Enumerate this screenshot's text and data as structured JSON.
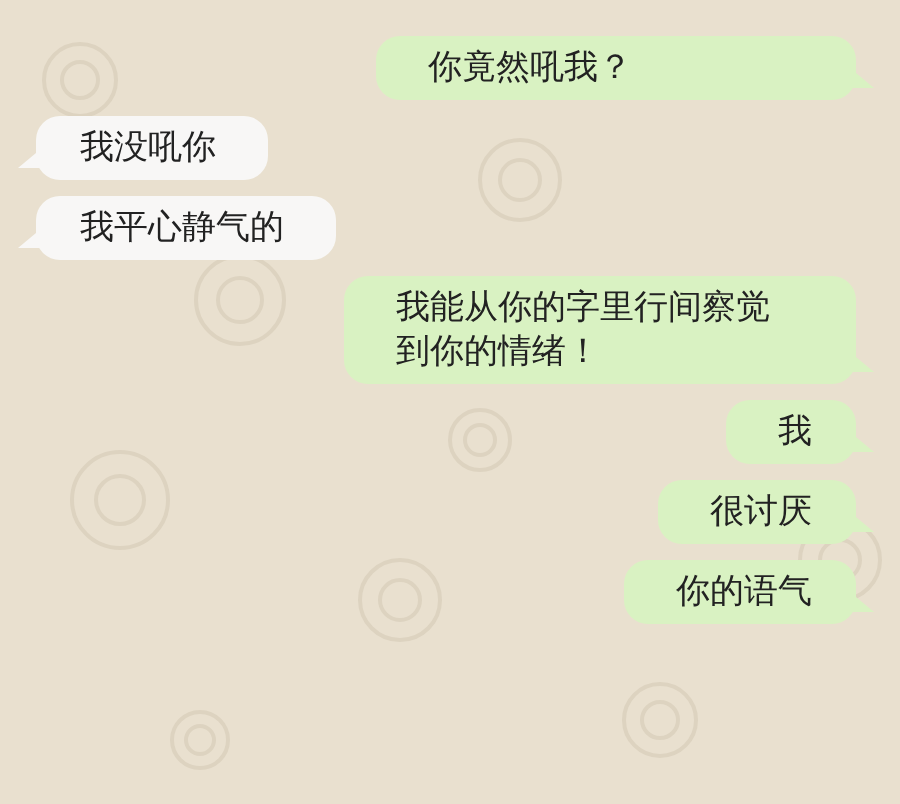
{
  "messages": [
    {
      "kind": "sent",
      "text": "你竟然吼我？"
    },
    {
      "kind": "received",
      "text": "我没吼你"
    },
    {
      "kind": "received",
      "text": "我平心静气的"
    },
    {
      "kind": "sent",
      "text": "我能从你的字里行间察觉到你的情绪！"
    },
    {
      "kind": "sent",
      "text": "我"
    },
    {
      "kind": "sent",
      "text": "很讨厌"
    },
    {
      "kind": "sent",
      "text": "你的语气"
    }
  ]
}
